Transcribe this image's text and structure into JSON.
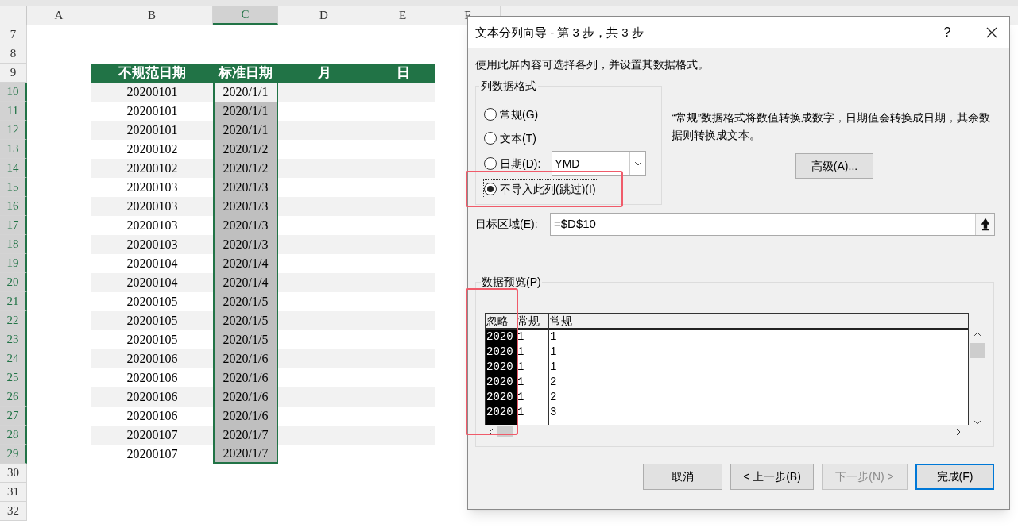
{
  "sheet": {
    "columns": [
      {
        "label": "A",
        "selected": false
      },
      {
        "label": "B",
        "selected": false
      },
      {
        "label": "C",
        "selected": true
      },
      {
        "label": "D",
        "selected": false
      },
      {
        "label": "E",
        "selected": false
      },
      {
        "label": "F",
        "selected": false
      }
    ],
    "top_rows": [
      {
        "number": "7"
      },
      {
        "number": "8"
      }
    ],
    "header_row": {
      "number": "9",
      "cells": [
        "不规范日期",
        "标准日期",
        "月",
        "日"
      ]
    },
    "rows": [
      {
        "number": "10",
        "selected": true,
        "active": true,
        "cells": [
          "",
          "20200101",
          "2020/1/1"
        ]
      },
      {
        "number": "11",
        "selected": true,
        "active": false,
        "cells": [
          "",
          "20200101",
          "2020/1/1"
        ]
      },
      {
        "number": "12",
        "selected": true,
        "active": false,
        "cells": [
          "",
          "20200101",
          "2020/1/1"
        ]
      },
      {
        "number": "13",
        "selected": true,
        "active": false,
        "cells": [
          "",
          "20200102",
          "2020/1/2"
        ]
      },
      {
        "number": "14",
        "selected": true,
        "active": false,
        "cells": [
          "",
          "20200102",
          "2020/1/2"
        ]
      },
      {
        "number": "15",
        "selected": true,
        "active": false,
        "cells": [
          "",
          "20200103",
          "2020/1/3"
        ]
      },
      {
        "number": "16",
        "selected": true,
        "active": false,
        "cells": [
          "",
          "20200103",
          "2020/1/3"
        ]
      },
      {
        "number": "17",
        "selected": true,
        "active": false,
        "cells": [
          "",
          "20200103",
          "2020/1/3"
        ]
      },
      {
        "number": "18",
        "selected": true,
        "active": false,
        "cells": [
          "",
          "20200103",
          "2020/1/3"
        ]
      },
      {
        "number": "19",
        "selected": true,
        "active": false,
        "cells": [
          "",
          "20200104",
          "2020/1/4"
        ]
      },
      {
        "number": "20",
        "selected": true,
        "active": false,
        "cells": [
          "",
          "20200104",
          "2020/1/4"
        ]
      },
      {
        "number": "21",
        "selected": true,
        "active": false,
        "cells": [
          "",
          "20200105",
          "2020/1/5"
        ]
      },
      {
        "number": "22",
        "selected": true,
        "active": false,
        "cells": [
          "",
          "20200105",
          "2020/1/5"
        ]
      },
      {
        "number": "23",
        "selected": true,
        "active": false,
        "cells": [
          "",
          "20200105",
          "2020/1/5"
        ]
      },
      {
        "number": "24",
        "selected": true,
        "active": false,
        "cells": [
          "",
          "20200106",
          "2020/1/6"
        ]
      },
      {
        "number": "25",
        "selected": true,
        "active": false,
        "cells": [
          "",
          "20200106",
          "2020/1/6"
        ]
      },
      {
        "number": "26",
        "selected": true,
        "active": false,
        "cells": [
          "",
          "20200106",
          "2020/1/6"
        ]
      },
      {
        "number": "27",
        "selected": true,
        "active": false,
        "cells": [
          "",
          "20200106",
          "2020/1/6"
        ]
      },
      {
        "number": "28",
        "selected": true,
        "active": false,
        "cells": [
          "",
          "20200107",
          "2020/1/7"
        ]
      },
      {
        "number": "29",
        "selected": true,
        "active": false,
        "cells": [
          "",
          "20200107",
          "2020/1/7"
        ]
      }
    ],
    "bottom_rows": [
      {
        "number": "30"
      },
      {
        "number": "31"
      },
      {
        "number": "32"
      }
    ]
  },
  "dialog": {
    "title": "文本分列向导 - 第 3 步，共 3 步",
    "help": "?",
    "instruction": "使用此屏内容可选择各列，并设置其数据格式。",
    "format_group": {
      "title": "列数据格式",
      "options": [
        {
          "label": "常规(G)",
          "selected": false,
          "highlighted": false
        },
        {
          "label": "文本(T)",
          "selected": false,
          "highlighted": false
        },
        {
          "label": "日期(D):",
          "selected": false,
          "highlighted": false
        },
        {
          "label": "不导入此列(跳过)(I)",
          "selected": true,
          "highlighted": true
        }
      ],
      "date_format": "YMD"
    },
    "description": "“常规”数据格式将数值转换成数字，日期值会转换成日期，其余数据则转换成文本。",
    "advanced_button": "高级(A)...",
    "destination": {
      "label": "目标区域(E):",
      "value": "=$D$10"
    },
    "preview": {
      "title": "数据预览(P)",
      "columns": [
        {
          "label": "忽略",
          "selected": true,
          "highlighted": true
        },
        {
          "label": "常规",
          "selected": false,
          "highlighted": false
        },
        {
          "label": "常规",
          "selected": false,
          "highlighted": false
        }
      ],
      "rows": [
        [
          "2020",
          "1",
          "1"
        ],
        [
          "2020",
          "1",
          "1"
        ],
        [
          "2020",
          "1",
          "1"
        ],
        [
          "2020",
          "1",
          "2"
        ],
        [
          "2020",
          "1",
          "2"
        ],
        [
          "2020",
          "1",
          "3"
        ]
      ]
    },
    "buttons": [
      {
        "label": "取消",
        "disabled": false,
        "default": false
      },
      {
        "label": "< 上一步(B)",
        "disabled": false,
        "default": false
      },
      {
        "label": "下一步(N) >",
        "disabled": true,
        "default": false
      },
      {
        "label": "完成(F)",
        "disabled": false,
        "default": true
      }
    ]
  }
}
